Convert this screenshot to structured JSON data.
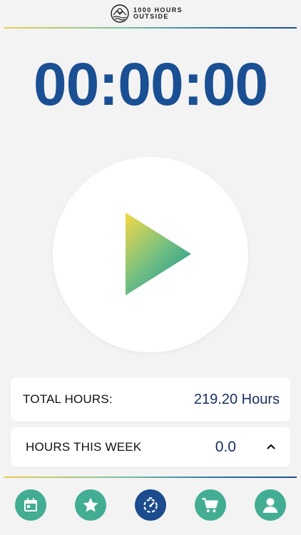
{
  "header": {
    "logo_line1": "1000 HOURS",
    "logo_line2": "OUTSIDE",
    "logo_icon": "sun-mountain-waves-icon"
  },
  "timer": {
    "display": "00:00:00"
  },
  "play_button": {
    "icon": "play-icon"
  },
  "stats": {
    "total_label": "TOTAL HOURS:",
    "total_value": "219.20 Hours",
    "week_label": "HOURS THIS WEEK",
    "week_value": "0.0",
    "week_toggle_icon": "chevron-up-icon"
  },
  "nav": {
    "items": [
      {
        "icon": "calendar-icon",
        "active": false
      },
      {
        "icon": "star-icon",
        "active": false
      },
      {
        "icon": "timer-icon",
        "active": true
      },
      {
        "icon": "cart-icon",
        "active": false
      },
      {
        "icon": "profile-icon",
        "active": false
      }
    ]
  },
  "colors": {
    "accent_navy": "#1a4f93",
    "accent_teal": "#43ad93",
    "accent_yellow": "#f2d54a",
    "background": "#f3f3f3"
  }
}
